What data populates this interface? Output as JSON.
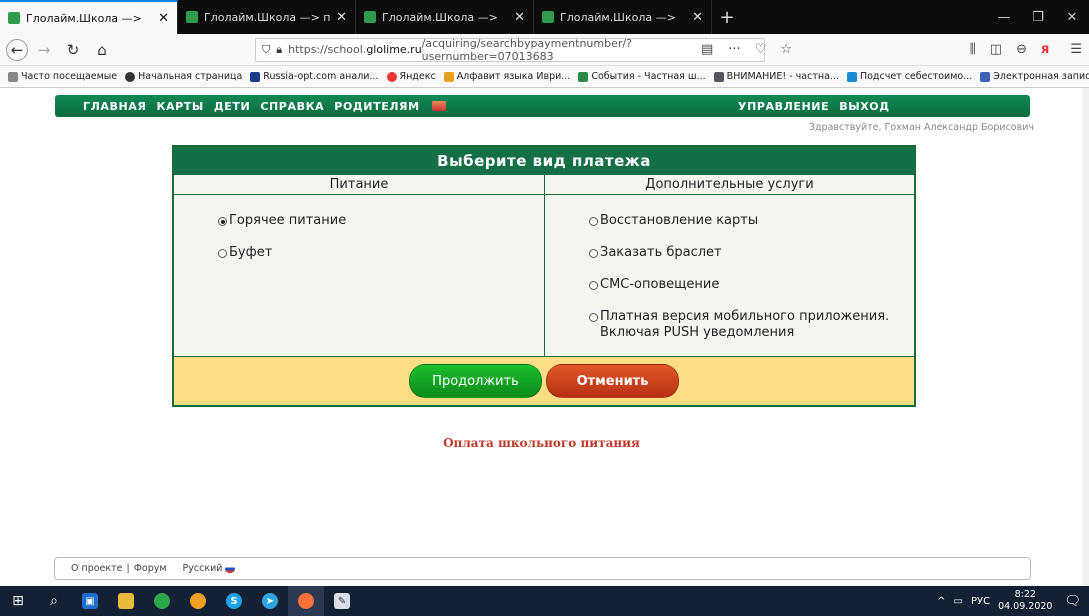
{
  "browser": {
    "tabs": [
      {
        "title": "Глолайм.Школа —>",
        "active": true
      },
      {
        "title": "Глолайм.Школа —> пользов",
        "active": false
      },
      {
        "title": "Глолайм.Школа —>",
        "active": false
      },
      {
        "title": "Глолайм.Школа —>",
        "active": false
      }
    ],
    "url_prefix": "https://school.",
    "url_host": "glolime.ru",
    "url_path": "/acquiring/searchbypaymentnumber/?usernumber=07013683",
    "bookmarks": [
      {
        "label": "Часто посещаемые",
        "color": "#888"
      },
      {
        "label": "Начальная страница",
        "color": "#333"
      },
      {
        "label": "Russia-opt.com анали...",
        "color": "#1a3a8c"
      },
      {
        "label": "Яндекс",
        "color": "#e33"
      },
      {
        "label": "Алфавит языка Иври...",
        "color": "#e9a21f"
      },
      {
        "label": "События - Частная ш...",
        "color": "#2a8b4a"
      },
      {
        "label": "ВНИМАНИЕ! - частна...",
        "color": "#556"
      },
      {
        "label": "Подсчет себестоимо...",
        "color": "#1c8bd6"
      },
      {
        "label": "Электронная запись ...",
        "color": "#3d63b8"
      }
    ]
  },
  "site": {
    "nav_left": [
      "ГЛАВНАЯ",
      "КАРТЫ",
      "ДЕТИ",
      "СПРАВКА",
      "РОДИТЕЛЯМ"
    ],
    "nav_right": [
      "УПРАВЛЕНИЕ",
      "ВЫХОД"
    ],
    "greeting": "Здравствуйте, Гохман Александр Борисович"
  },
  "payment": {
    "title": "Выберите вид платежа",
    "col_left": "Питание",
    "col_right": "Дополнительные услуги",
    "left_options": [
      {
        "label": "Горячее питание",
        "selected": true
      },
      {
        "label": "Буфет",
        "selected": false
      }
    ],
    "right_options": [
      {
        "label": "Восстановление карты",
        "selected": false
      },
      {
        "label": "Заказать браслет",
        "selected": false
      },
      {
        "label": "СМС-оповещение",
        "selected": false
      },
      {
        "label": "Платная версия мобильного приложения. Включая PUSH уведомления",
        "selected": false
      }
    ],
    "continue_label": "Продолжить",
    "cancel_label": "Отменить",
    "subtitle": "Оплата школьного питания"
  },
  "footer": {
    "about": "О проекте",
    "forum": "Форум",
    "language": "Русский"
  },
  "taskbar": {
    "lang": "РУС",
    "time": "8:22",
    "date": "04.09.2020"
  }
}
